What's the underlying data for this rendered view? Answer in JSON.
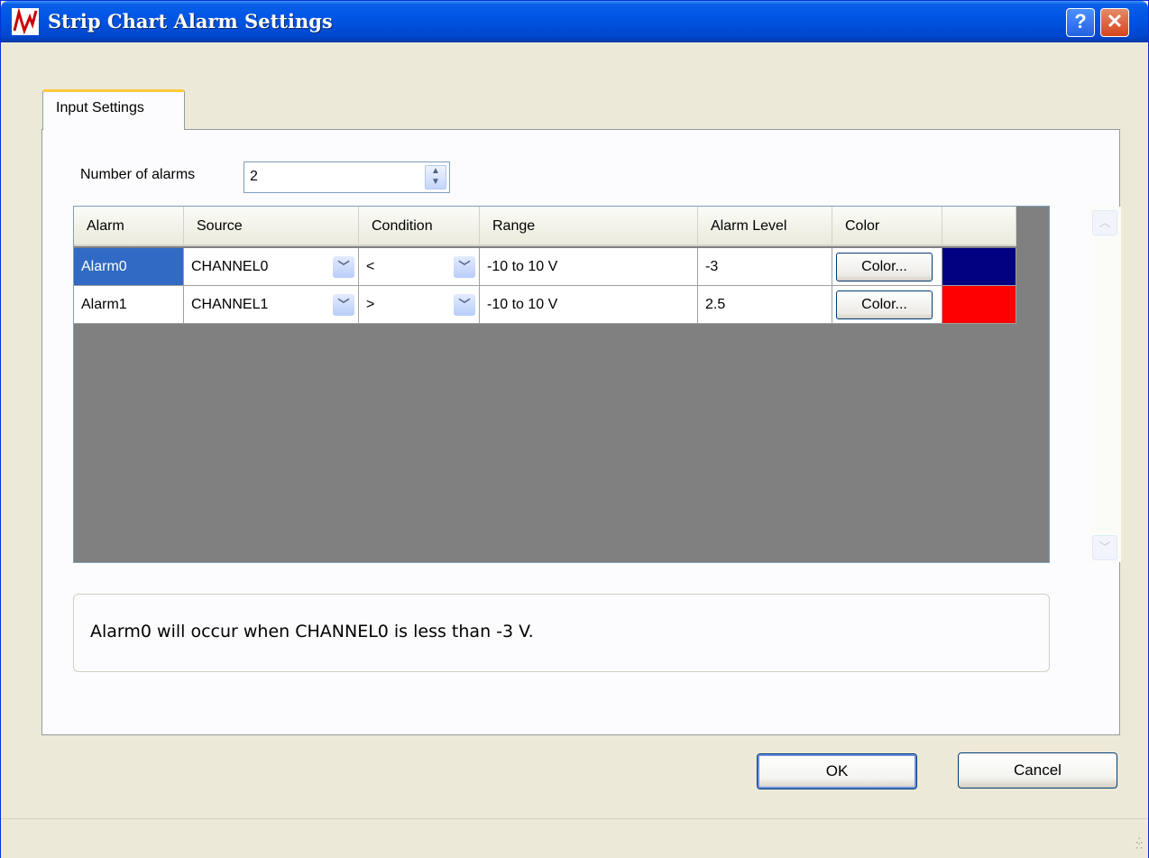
{
  "window": {
    "title": "Strip Chart Alarm Settings",
    "help_label": "?",
    "close_label": "✕"
  },
  "tabs": [
    {
      "label": "Input Settings",
      "active": true
    }
  ],
  "num_alarms": {
    "label": "Number of alarms",
    "value": "2"
  },
  "table": {
    "headers": [
      "Alarm",
      "Source",
      "Condition",
      "Range",
      "Alarm Level",
      "Color"
    ],
    "rows": [
      {
        "alarm": "Alarm0",
        "source": "CHANNEL0",
        "condition": "<",
        "range": "-10 to 10 V",
        "level": "-3",
        "color_button": "Color...",
        "swatch": "#000080",
        "selected": true
      },
      {
        "alarm": "Alarm1",
        "source": "CHANNEL1",
        "condition": ">",
        "range": "-10 to 10 V",
        "level": "2.5",
        "color_button": "Color...",
        "swatch": "#ff0000",
        "selected": false
      }
    ]
  },
  "status_message": "Alarm0 will occur when CHANNEL0 is less than -3 V.",
  "buttons": {
    "ok": "OK",
    "cancel": "Cancel"
  },
  "icons": {
    "app": "waveform-icon",
    "dropdown": "chevron-down-icon",
    "spin": "up-down-arrows-icon"
  }
}
